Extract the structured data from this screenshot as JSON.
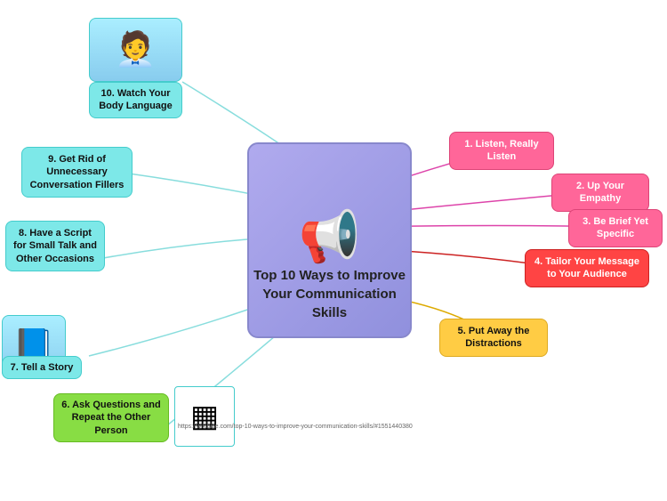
{
  "title": "Top 10 Ways to Improve Your Communication Skills",
  "nodes": {
    "center": {
      "label": "Top 10 Ways to Improve Your Communication Skills"
    },
    "n1": {
      "id": 1,
      "label": "1. Listen, Really Listen",
      "color": "pink"
    },
    "n2": {
      "id": 2,
      "label": "2. Up Your Empathy",
      "color": "pink"
    },
    "n3": {
      "id": 3,
      "label": "3. Be Brief Yet Specific",
      "color": "pink"
    },
    "n4": {
      "id": 4,
      "label": "4. Tailor Your Message to Your Audience",
      "color": "red"
    },
    "n5": {
      "id": 5,
      "label": "5. Put Away the Distractions",
      "color": "orange"
    },
    "n6": {
      "id": 6,
      "label": "6. Ask Questions and Repeat the Other Person",
      "color": "green"
    },
    "n7": {
      "id": 7,
      "label": "7. Tell a Story",
      "color": "cyan"
    },
    "n8": {
      "id": 8,
      "label": "8. Have a Script for Small Talk and Other Occasions",
      "color": "cyan"
    },
    "n9": {
      "id": 9,
      "label": "9. Get Rid of Unnecessary Conversation Fillers",
      "color": "cyan"
    },
    "n10": {
      "id": 10,
      "label": "10. Watch Your Body Language",
      "color": "cyan"
    }
  },
  "url": "https://wikibize.com/top-10-ways-to-improve-your-communication-skills/#1551440380"
}
